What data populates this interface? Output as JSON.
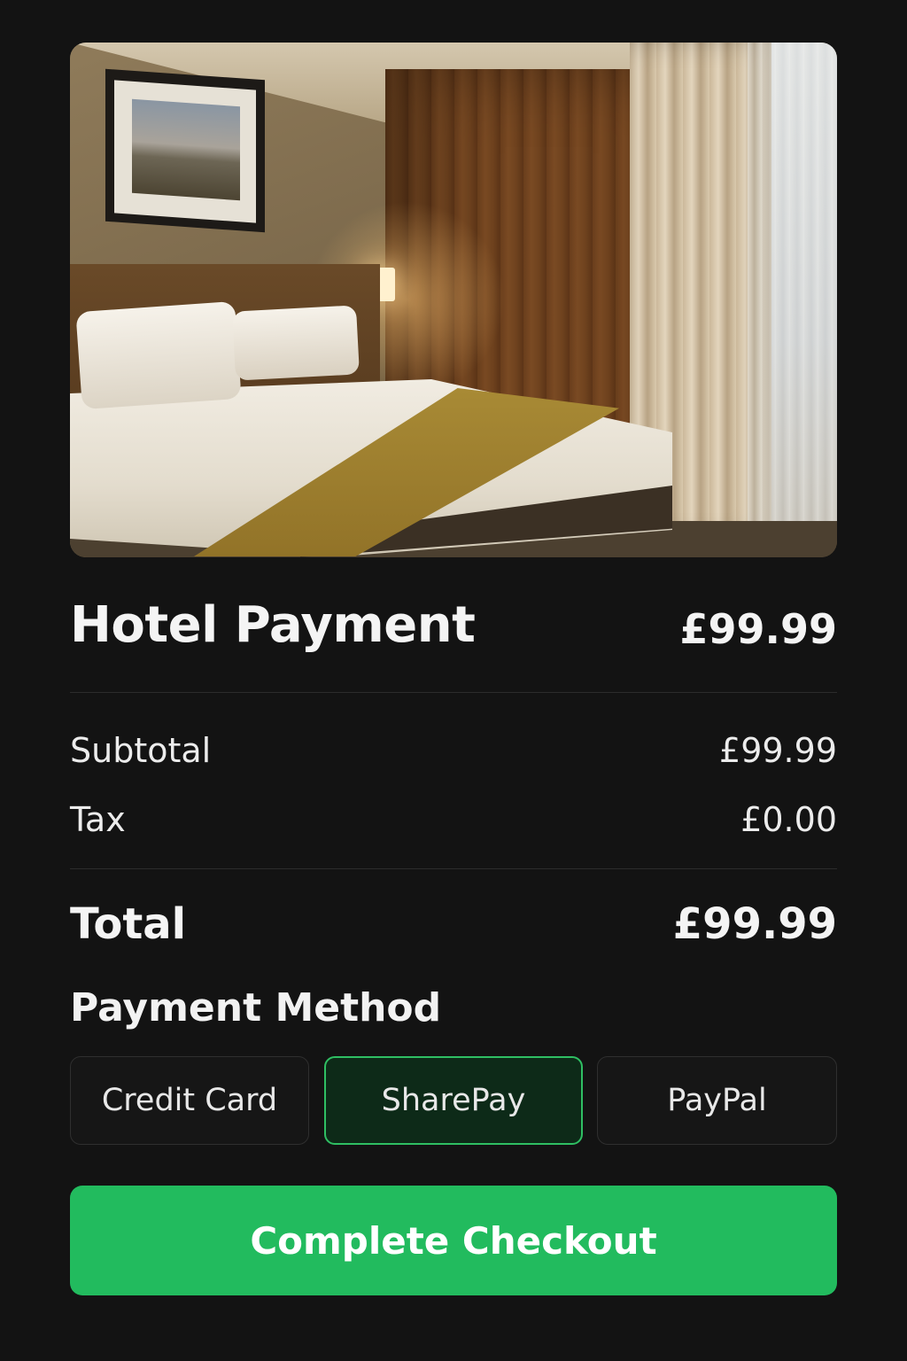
{
  "header": {
    "title": "Hotel Payment",
    "price": "£99.99"
  },
  "summary": {
    "subtotal_label": "Subtotal",
    "subtotal_value": "£99.99",
    "tax_label": "Tax",
    "tax_value": "£0.00",
    "total_label": "Total",
    "total_value": "£99.99"
  },
  "payment": {
    "heading": "Payment Method",
    "methods": [
      {
        "label": "Credit Card",
        "selected": false
      },
      {
        "label": "SharePay",
        "selected": true
      },
      {
        "label": "PayPal",
        "selected": false
      }
    ]
  },
  "checkout": {
    "label": "Complete Checkout"
  },
  "colors": {
    "background": "#131313",
    "accent": "#22bb5e",
    "selected_border": "#2fbf63",
    "selected_fill": "#0d2a18"
  }
}
